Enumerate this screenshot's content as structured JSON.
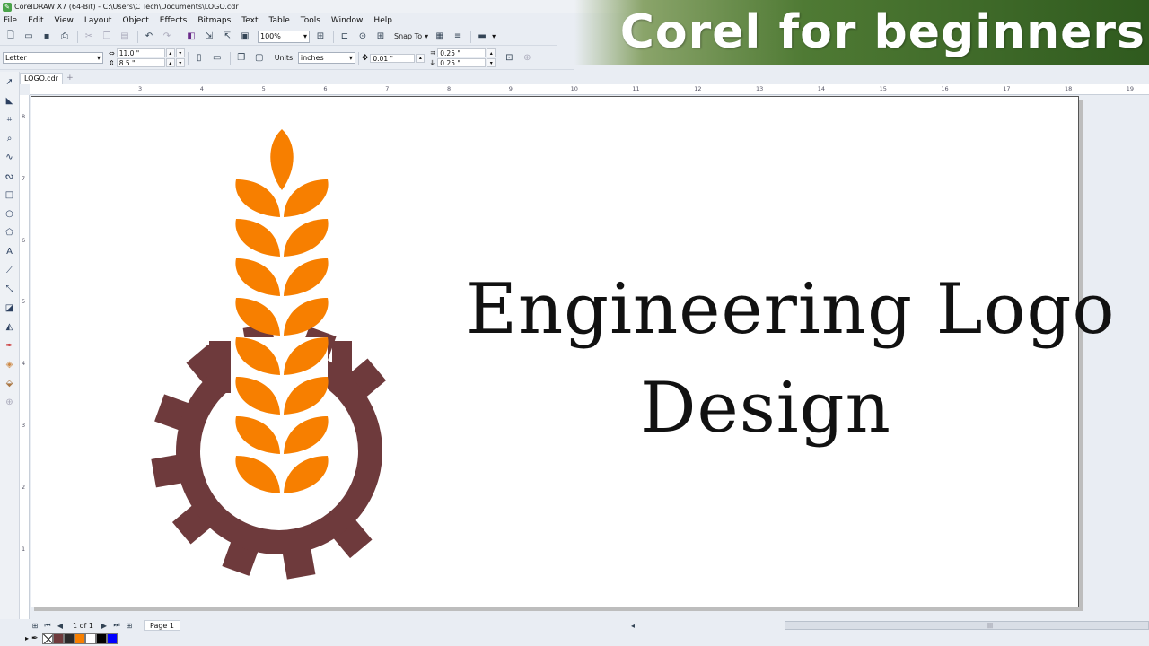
{
  "window": {
    "title": "CorelDRAW X7 (64-Bit) - C:\\Users\\C Tech\\Documents\\LOGO.cdr"
  },
  "banner": {
    "text": "Corel for beginners"
  },
  "menu": {
    "items": [
      "File",
      "Edit",
      "View",
      "Layout",
      "Object",
      "Effects",
      "Bitmaps",
      "Text",
      "Table",
      "Tools",
      "Window",
      "Help"
    ]
  },
  "toolbar": {
    "zoom": "100%",
    "snap_label": "Snap To"
  },
  "property_bar": {
    "page_size": "Letter",
    "width": "11.0 \"",
    "height": "8.5 \"",
    "units_label": "Units:",
    "units_value": "inches",
    "nudge": "0.01 \"",
    "dup_x": "0.25 \"",
    "dup_y": "0.25 \""
  },
  "document": {
    "tab_name": "LOGO.cdr"
  },
  "ruler": {
    "h_labels": [
      "3",
      "4",
      "5",
      "6",
      "7",
      "8",
      "9",
      "10",
      "11",
      "12",
      "13",
      "14",
      "15",
      "16",
      "17",
      "18",
      "19"
    ],
    "v_labels": [
      "8",
      "7",
      "6",
      "5",
      "4",
      "3",
      "2",
      "1"
    ]
  },
  "canvas": {
    "title_line1": "Engineering Logo",
    "title_line2": "Design",
    "colors": {
      "wheat": "#F77F00",
      "gear": "#6E3A3C",
      "text": "#111111"
    }
  },
  "page_nav": {
    "count": "1 of 1",
    "page_tab": "Page 1"
  },
  "palette": {
    "colors": [
      "#6E3A3C",
      "#2a2a2a",
      "#F77F00",
      "#ffffff",
      "#000000",
      "#0000ff"
    ]
  }
}
